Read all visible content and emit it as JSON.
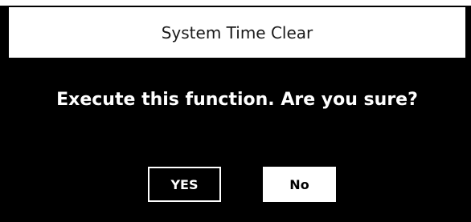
{
  "dialog": {
    "title": "System Time Clear",
    "message": "Execute this function. Are you sure?",
    "buttons": {
      "yes_label": "YES",
      "no_label": "No"
    }
  },
  "colors": {
    "background": "#000000",
    "title_bar": "#ffffff",
    "text_light": "#ffffff",
    "text_dark": "#000000"
  }
}
